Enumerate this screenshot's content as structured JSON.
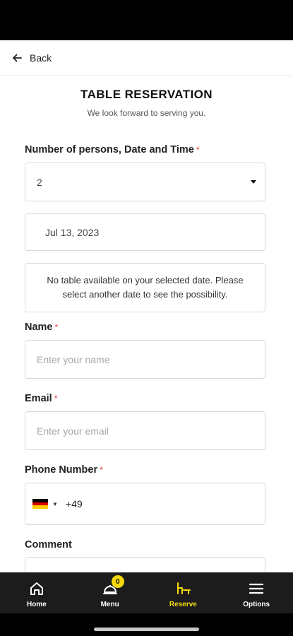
{
  "header": {
    "back_label": "Back"
  },
  "page": {
    "title": "TABLE RESERVATION",
    "subtitle": "We look forward to serving you."
  },
  "form": {
    "persons_label": "Number of persons, Date and Time",
    "persons_value": "2",
    "date_value": "Jul 13, 2023",
    "notice": "No table available on your selected date. Please select another date to see the possibility.",
    "name_label": "Name",
    "name_placeholder": "Enter your name",
    "email_label": "Email",
    "email_placeholder": "Enter your email",
    "phone_label": "Phone Number",
    "phone_dial_code": "+49",
    "phone_country_flag": "germany-flag",
    "comment_label": "Comment",
    "required_mark": "*"
  },
  "tabbar": {
    "tabs": [
      {
        "label": "Home",
        "icon": "home-icon"
      },
      {
        "label": "Menu",
        "icon": "cloche-icon",
        "badge": "0"
      },
      {
        "label": "Reserve",
        "icon": "reserve-icon",
        "active": true
      },
      {
        "label": "Options",
        "icon": "hamburger-icon"
      }
    ]
  },
  "colors": {
    "accent": "#f5d90a",
    "required": "#e53935",
    "tabbar_bg": "#1c1c1c"
  }
}
